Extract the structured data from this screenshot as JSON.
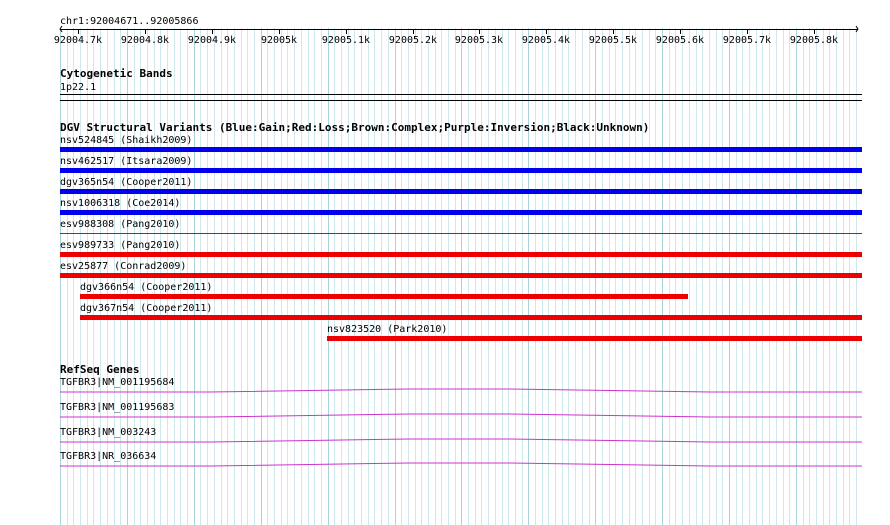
{
  "locus": "chr1:92004671..92005866",
  "ruler": {
    "ticks": [
      "92004.7k",
      "92004.8k",
      "92004.9k",
      "92005k",
      "92005.1k",
      "92005.2k",
      "92005.3k",
      "92005.4k",
      "92005.5k",
      "92005.6k",
      "92005.7k",
      "92005.8k"
    ]
  },
  "cytoband": {
    "title": "Cytogenetic Bands",
    "band": "1p22.1"
  },
  "dgv": {
    "title": "DGV Structural Variants (Blue:Gain;Red:Loss;Brown:Complex;Purple:Inversion;Black:Unknown)",
    "colors": {
      "gain": "#0000ee",
      "loss": "#ee0000"
    },
    "variants": [
      {
        "label": "nsv524845 (Shaikh2009)",
        "type": "gain"
      },
      {
        "label": "nsv462517 (Itsara2009)",
        "type": "gain"
      },
      {
        "label": "dgv365n54 (Cooper2011)",
        "type": "gain"
      },
      {
        "label": "nsv1006318 (Coe2014)",
        "type": "gain"
      },
      {
        "label": "esv988308 (Pang2010)",
        "type": "loss"
      },
      {
        "label": "esv989733 (Pang2010)",
        "type": "loss"
      },
      {
        "label": "esv25877 (Conrad2009)",
        "type": "loss"
      },
      {
        "label": "dgv366n54 (Cooper2011)",
        "type": "loss"
      },
      {
        "label": "dgv367n54 (Cooper2011)",
        "type": "loss"
      },
      {
        "label": "nsv823520 (Park2010)",
        "type": "loss"
      }
    ]
  },
  "refseq": {
    "title": "RefSeq Genes",
    "color": "#cc33cc",
    "genes": [
      {
        "label": "TGFBR3|NM_001195684"
      },
      {
        "label": "TGFBR3|NM_001195683"
      },
      {
        "label": "TGFBR3|NM_003243"
      },
      {
        "label": "TGFBR3|NR_036634"
      }
    ]
  }
}
